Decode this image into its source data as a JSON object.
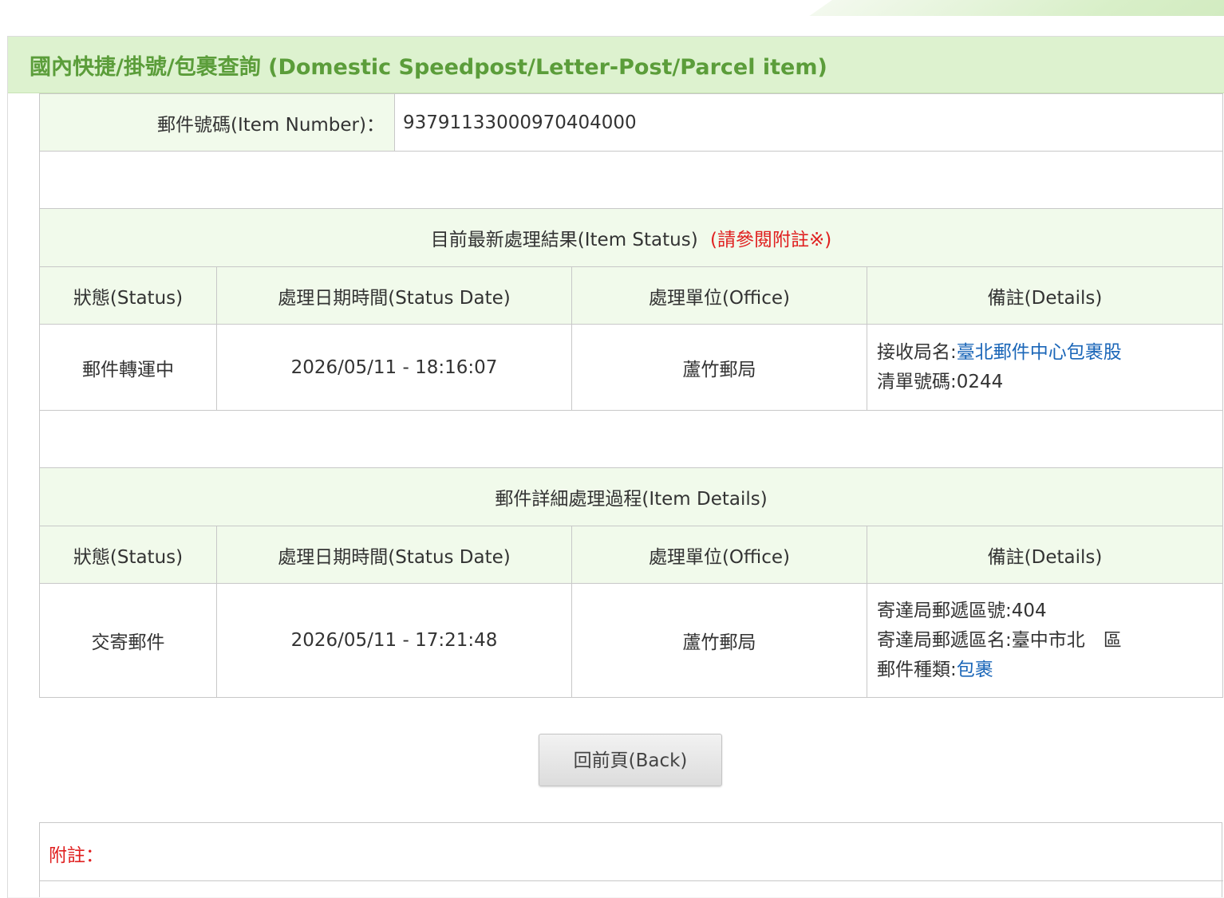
{
  "page": {
    "title": "國內快捷/掛號/包裹查詢 (Domestic Speedpost/Letter-Post/Parcel item)"
  },
  "item": {
    "label": "郵件號碼(Item Number)：",
    "number": "93791133000970404000"
  },
  "latest": {
    "heading": "目前最新處理結果(Item Status)",
    "note_link": "(請參閱附註※)",
    "columns": [
      "狀態(Status)",
      "處理日期時間(Status Date)",
      "處理單位(Office)",
      "備註(Details)"
    ],
    "row": {
      "status": "郵件轉運中",
      "date": "2026/05/11 - 18:16:07",
      "office": "蘆竹郵局",
      "details_line1_label": "接收局名:",
      "details_line1_value": "臺北郵件中心包裹股",
      "details_line2": "清單號碼:0244"
    }
  },
  "history": {
    "heading": "郵件詳細處理過程(Item Details)",
    "columns": [
      "狀態(Status)",
      "處理日期時間(Status Date)",
      "處理單位(Office)",
      "備註(Details)"
    ],
    "row": {
      "status": "交寄郵件",
      "date": "2026/05/11 - 17:21:48",
      "office": "蘆竹郵局",
      "details_line1": "寄達局郵遞區號:404",
      "details_line2": "寄達局郵遞區名:臺中市北　區",
      "details_line3_label": "郵件種類:",
      "details_line3_value": "包裹"
    }
  },
  "back_button": "回前頁(Back)",
  "footnote": {
    "label": "附註："
  },
  "colors": {
    "title_green": "#5b9d3a",
    "header_bg": "#ddf2cf",
    "cell_header_bg": "#f1faeb",
    "link_blue": "#1a66b8",
    "note_red": "#e02020"
  }
}
